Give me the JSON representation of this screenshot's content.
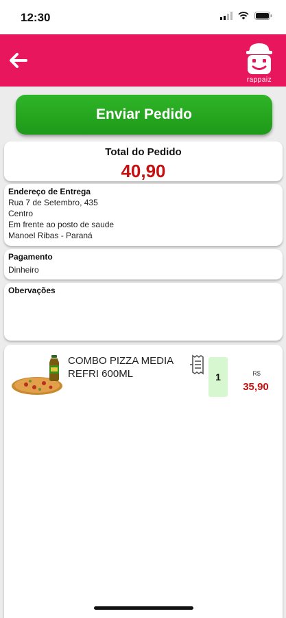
{
  "status_bar": {
    "time": "12:30"
  },
  "header": {
    "back_icon": "arrow-left-icon",
    "logo_text": "rappaiz",
    "color": "#e8175d"
  },
  "actions": {
    "send_label": "Enviar Pedido",
    "send_color": "#22a51c"
  },
  "total": {
    "label": "Total do Pedido",
    "value": "40,90"
  },
  "address": {
    "title": "Endereço de Entrega",
    "lines": [
      "Rua 7 de Setembro, 435",
      "Centro",
      "Em frente ao posto de saude",
      "Manoel Ribas - Paraná"
    ]
  },
  "payment": {
    "title": "Pagamento",
    "method": "Dinheiro"
  },
  "notes": {
    "title": "Obervações",
    "text": ""
  },
  "items": [
    {
      "name": "COMBO PIZZA MEDIA REFRI 600ML",
      "quantity": "1",
      "currency": "R$",
      "price": "35,90"
    }
  ],
  "colors": {
    "price": "#c41111",
    "qty_bg": "#d7f7d0"
  }
}
